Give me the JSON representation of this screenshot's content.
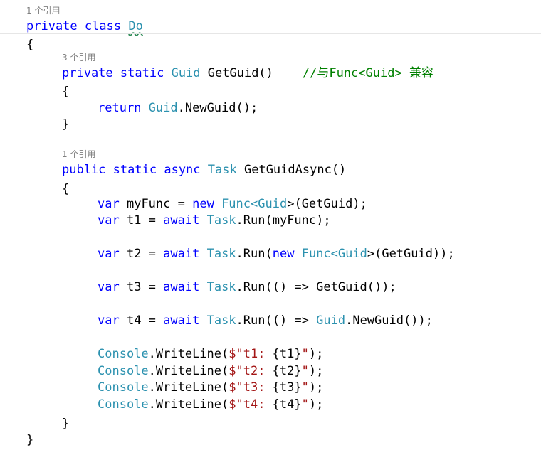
{
  "code_lens": {
    "class_refs": "1 个引用",
    "getguid_refs": "3 个引用",
    "getguidasync_refs": "1 个引用"
  },
  "code": {
    "class_decl": {
      "k1": "private",
      "k2": "class",
      "name": "Do"
    },
    "brace_open": "{",
    "brace_close": "}",
    "getguid_decl": {
      "k1": "private",
      "k2": "static",
      "type": "Guid",
      "rest": "GetGuid()",
      "comment": "//与Func<Guid> 兼容"
    },
    "getguid_body": {
      "kw": "return",
      "type": "Guid",
      "rest": ".NewGuid();"
    },
    "async_decl": {
      "k1": "public",
      "k2": "static",
      "k3": "async",
      "type": "Task",
      "rest": "GetGuidAsync()"
    },
    "l_myfunc": {
      "var": "var",
      "a": "myFunc = ",
      "new": "new",
      "func": "Func",
      "lt": "<",
      "guid": "Guid",
      "b": ">(GetGuid);"
    },
    "l_t1": {
      "var": "var",
      "a": "t1 = ",
      "await": "await",
      "task": "Task",
      "b": ".Run(myFunc);"
    },
    "l_t2": {
      "var": "var",
      "a": "t2 = ",
      "await": "await",
      "task": "Task",
      "b": ".Run(",
      "new": "new",
      "func": "Func",
      "lt": "<",
      "guid": "Guid",
      "c": ">(GetGuid));"
    },
    "l_t3": {
      "var": "var",
      "a": "t3 = ",
      "await": "await",
      "task": "Task",
      "b": ".Run(() => GetGuid());"
    },
    "l_t4": {
      "var": "var",
      "a": "t4 = ",
      "await": "await",
      "task": "Task",
      "b": ".Run(() => ",
      "guid": "Guid",
      "c": ".NewGuid());"
    },
    "console": [
      {
        "cls": "Console",
        "m": ".WriteLine(",
        "s": "$\"t1: ",
        "i": "{t1}",
        "e": "\"",
        "end": ");"
      },
      {
        "cls": "Console",
        "m": ".WriteLine(",
        "s": "$\"t2: ",
        "i": "{t2}",
        "e": "\"",
        "end": ");"
      },
      {
        "cls": "Console",
        "m": ".WriteLine(",
        "s": "$\"t3: ",
        "i": "{t3}",
        "e": "\"",
        "end": ");"
      },
      {
        "cls": "Console",
        "m": ".WriteLine(",
        "s": "$\"t4: ",
        "i": "{t4}",
        "e": "\"",
        "end": ");"
      }
    ]
  },
  "colors": {
    "keyword": "#0000ff",
    "type": "#2b91af",
    "string": "#a31515",
    "comment": "#008000",
    "codelens": "#808080"
  }
}
